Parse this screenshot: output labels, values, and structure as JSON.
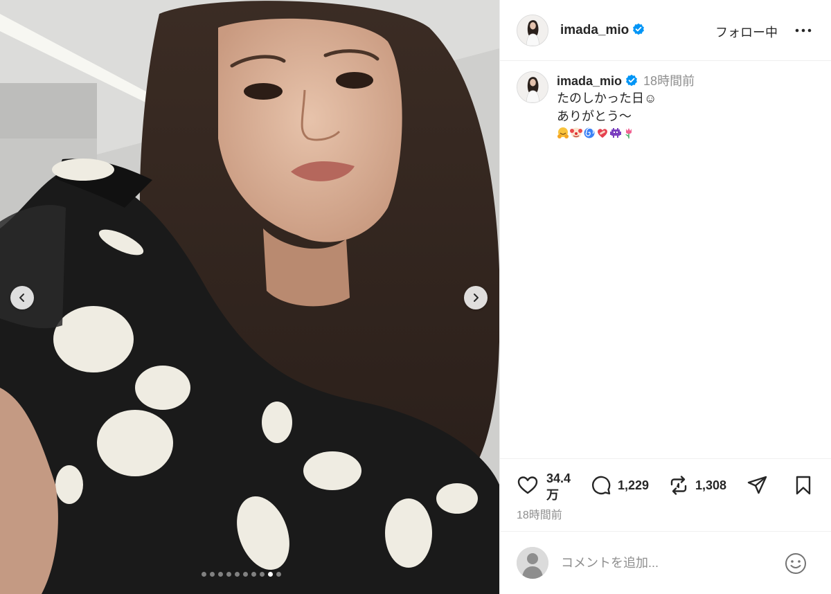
{
  "post": {
    "username": "imada_mio",
    "follow_state": "フォロー中",
    "caption_time": "18時間前",
    "caption_lines": [
      "たのしかった日☺",
      "ありがとう〜"
    ],
    "emojis": [
      "hugging-face-emoji",
      "clown-face-emoji",
      "cyclone-emoji",
      "mending-heart-emoji",
      "alien-monster-emoji",
      "tulip-emoji"
    ],
    "likes_count": "34.4万",
    "comments_count": "1,229",
    "reposts_count": "1,308",
    "post_time": "18時間前",
    "comment_placeholder": "コメントを追加..."
  },
  "carousel": {
    "slide_count": 10,
    "active_index": 8
  },
  "colors": {
    "verified": "#0095f6",
    "text_primary": "#262626",
    "text_secondary": "#8e8e8e",
    "divider": "#efefef"
  }
}
